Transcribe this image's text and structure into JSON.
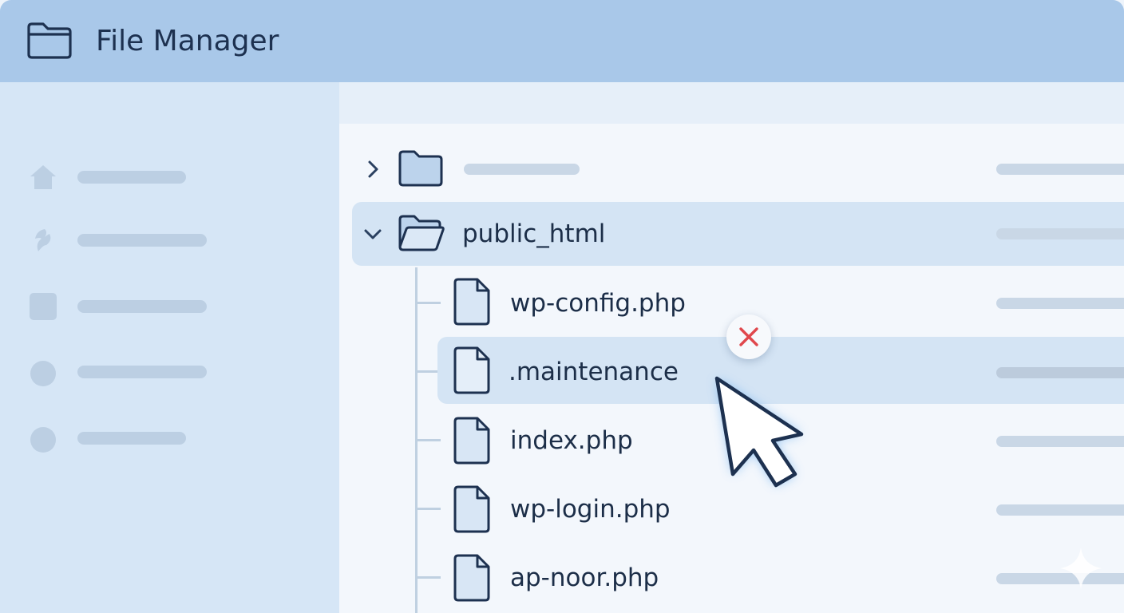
{
  "app": {
    "title": "File Manager",
    "icon": "folder-icon"
  },
  "sidebar": {
    "items": [
      {
        "icon": "home-icon"
      },
      {
        "icon": "leaf-icon"
      },
      {
        "icon": "square-icon"
      },
      {
        "icon": "circle-icon"
      },
      {
        "icon": "circle-icon"
      }
    ]
  },
  "tree": {
    "collapsed_folder": {
      "icon": "folder-icon",
      "expanded": false
    },
    "expanded_folder": {
      "name": "public_html",
      "icon": "folder-open-icon",
      "expanded": true
    },
    "files": [
      {
        "name": "wp-config.php",
        "icon": "file-icon",
        "selected": false
      },
      {
        "name": ".maintenance",
        "icon": "file-icon",
        "selected": true
      },
      {
        "name": "index.php",
        "icon": "file-icon",
        "selected": false
      },
      {
        "name": "wp-login.php",
        "icon": "file-icon",
        "selected": false
      },
      {
        "name": "ap-noor.php",
        "icon": "file-icon",
        "selected": false
      }
    ]
  },
  "actions": {
    "delete_icon": "close-icon",
    "delete_color": "#e0474c"
  },
  "cursor": {
    "icon": "pointer-cursor-icon"
  },
  "colors": {
    "header": "#a9c8e9",
    "sidebar": "#d6e6f6",
    "highlight": "#d4e4f4",
    "text": "#1c2e48"
  }
}
